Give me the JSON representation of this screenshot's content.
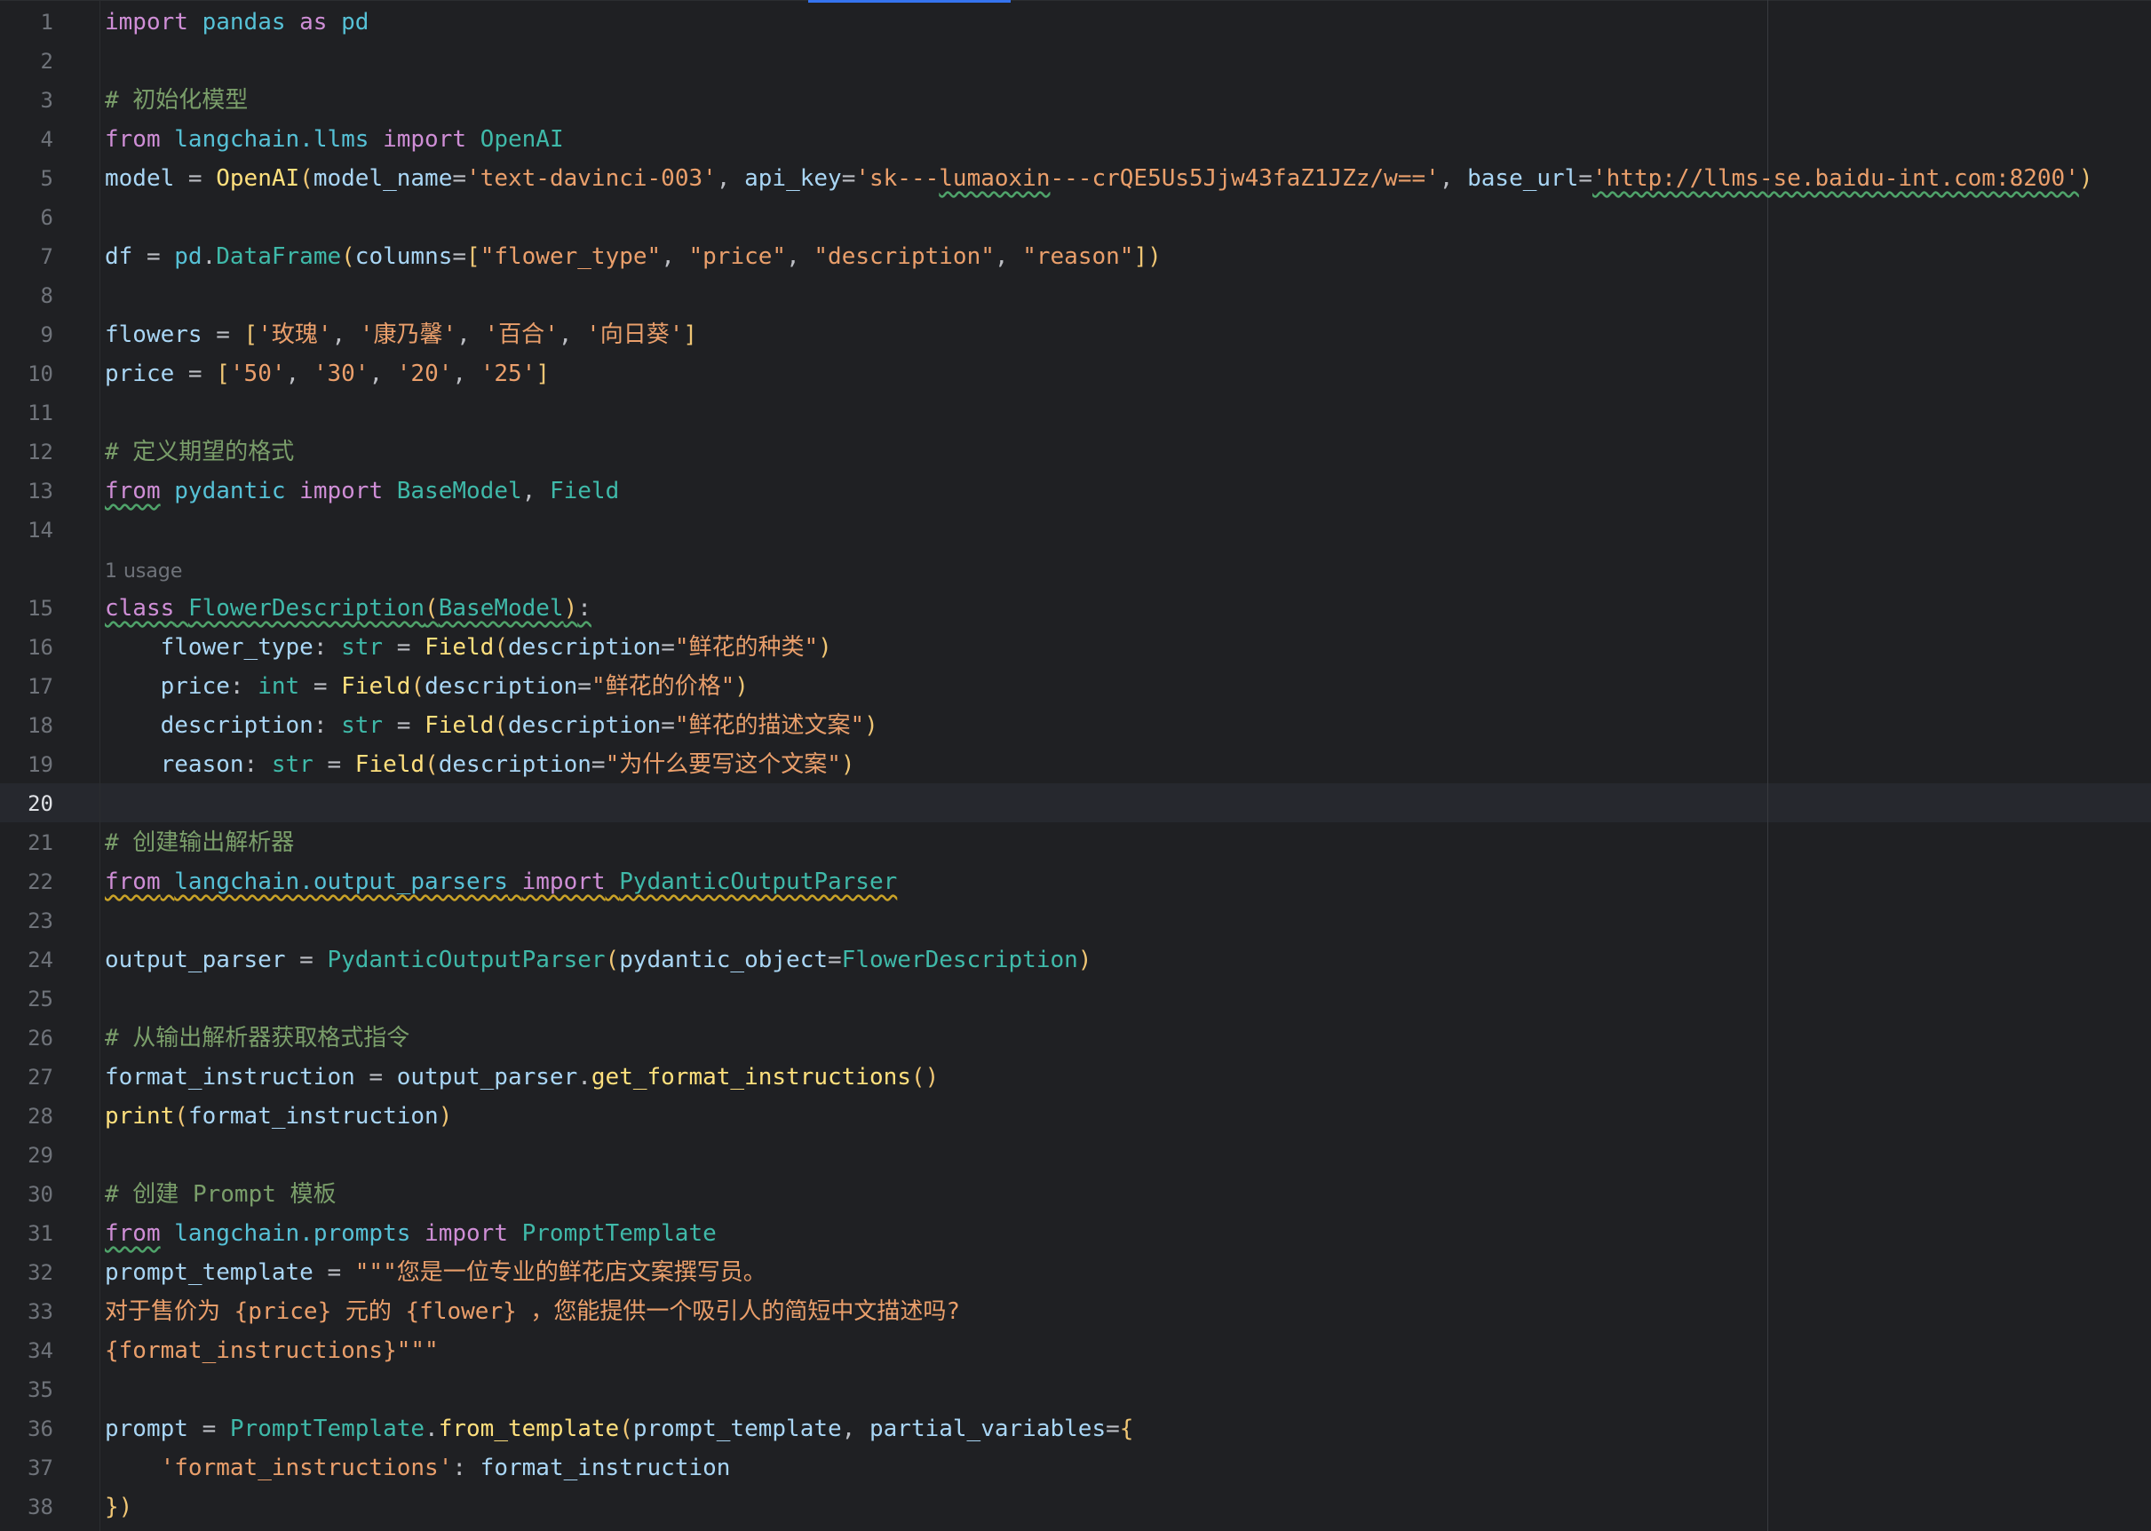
{
  "editor": {
    "lines": [
      {
        "n": "1",
        "t": [
          [
            "kw",
            "import"
          ],
          [
            "op",
            " "
          ],
          [
            "mod",
            "pandas"
          ],
          [
            "op",
            " "
          ],
          [
            "kw",
            "as"
          ],
          [
            "op",
            " "
          ],
          [
            "mod",
            "pd"
          ]
        ]
      },
      {
        "n": "2",
        "t": []
      },
      {
        "n": "3",
        "t": [
          [
            "cm",
            "# 初始化模型"
          ]
        ]
      },
      {
        "n": "4",
        "t": [
          [
            "kw",
            "from"
          ],
          [
            "op",
            " "
          ],
          [
            "mod",
            "langchain.llms"
          ],
          [
            "op",
            " "
          ],
          [
            "kw",
            "import"
          ],
          [
            "op",
            " "
          ],
          [
            "cls",
            "OpenAI"
          ]
        ]
      },
      {
        "n": "5",
        "t": [
          [
            "var",
            "model"
          ],
          [
            "op",
            " = "
          ],
          [
            "fn",
            "OpenAI"
          ],
          [
            "pa",
            "("
          ],
          [
            "var",
            "model_name"
          ],
          [
            "op",
            "="
          ],
          [
            "str",
            "'text-davinci-003'"
          ],
          [
            "op",
            ", "
          ],
          [
            "var",
            "api_key"
          ],
          [
            "op",
            "="
          ],
          [
            "str",
            "'sk---"
          ],
          [
            "str wavy",
            "lumaoxin"
          ],
          [
            "str",
            "---crQE5Us5Jjw43faZ1JZz/w=='"
          ],
          [
            "op",
            ", "
          ],
          [
            "var",
            "base_url"
          ],
          [
            "op",
            "="
          ],
          [
            "str wavy",
            "'http://llms-se.baidu-int.com:8200'"
          ],
          [
            "pa",
            ")"
          ]
        ]
      },
      {
        "n": "6",
        "t": []
      },
      {
        "n": "7",
        "t": [
          [
            "var",
            "df"
          ],
          [
            "op",
            " = "
          ],
          [
            "mod",
            "pd"
          ],
          [
            "op",
            "."
          ],
          [
            "cls",
            "DataFrame"
          ],
          [
            "pa",
            "("
          ],
          [
            "var",
            "columns"
          ],
          [
            "op",
            "="
          ],
          [
            "pa",
            "["
          ],
          [
            "str",
            "\"flower_type\""
          ],
          [
            "op",
            ", "
          ],
          [
            "str",
            "\"price\""
          ],
          [
            "op",
            ", "
          ],
          [
            "str",
            "\"description\""
          ],
          [
            "op",
            ", "
          ],
          [
            "str",
            "\"reason\""
          ],
          [
            "pa",
            "])"
          ]
        ]
      },
      {
        "n": "8",
        "t": []
      },
      {
        "n": "9",
        "t": [
          [
            "var",
            "flowers"
          ],
          [
            "op",
            " = "
          ],
          [
            "pa",
            "["
          ],
          [
            "str",
            "'玫瑰'"
          ],
          [
            "op",
            ", "
          ],
          [
            "str",
            "'康乃馨'"
          ],
          [
            "op",
            ", "
          ],
          [
            "str",
            "'百合'"
          ],
          [
            "op",
            ", "
          ],
          [
            "str",
            "'向日葵'"
          ],
          [
            "pa",
            "]"
          ]
        ]
      },
      {
        "n": "10",
        "t": [
          [
            "var",
            "price"
          ],
          [
            "op",
            " = "
          ],
          [
            "pa",
            "["
          ],
          [
            "str",
            "'50'"
          ],
          [
            "op",
            ", "
          ],
          [
            "str",
            "'30'"
          ],
          [
            "op",
            ", "
          ],
          [
            "str",
            "'20'"
          ],
          [
            "op",
            ", "
          ],
          [
            "str",
            "'25'"
          ],
          [
            "pa",
            "]"
          ]
        ]
      },
      {
        "n": "11",
        "t": []
      },
      {
        "n": "12",
        "t": [
          [
            "cm",
            "# 定义期望的格式"
          ]
        ]
      },
      {
        "n": "13",
        "t": [
          [
            "kw wavy",
            "from"
          ],
          [
            "op",
            " "
          ],
          [
            "mod",
            "pydantic"
          ],
          [
            "op",
            " "
          ],
          [
            "kw",
            "import"
          ],
          [
            "op",
            " "
          ],
          [
            "cls",
            "BaseModel"
          ],
          [
            "op",
            ", "
          ],
          [
            "cls",
            "Field"
          ]
        ]
      },
      {
        "n": "14",
        "t": []
      },
      {
        "hint": "1 usage"
      },
      {
        "n": "15",
        "t": [
          [
            "kw wavy",
            "class"
          ],
          [
            "op wavy",
            " "
          ],
          [
            "cls wavy",
            "FlowerDescription"
          ],
          [
            "pa wavy",
            "("
          ],
          [
            "cls wavy",
            "BaseModel"
          ],
          [
            "pa wavy",
            ")"
          ],
          [
            "op wavy",
            ":"
          ]
        ]
      },
      {
        "n": "16",
        "t": [
          [
            "op",
            "    "
          ],
          [
            "var",
            "flower_type"
          ],
          [
            "op",
            ": "
          ],
          [
            "cls",
            "str"
          ],
          [
            "op",
            " = "
          ],
          [
            "fn",
            "Field"
          ],
          [
            "pa",
            "("
          ],
          [
            "var",
            "description"
          ],
          [
            "op",
            "="
          ],
          [
            "str",
            "\"鲜花的种类\""
          ],
          [
            "pa",
            ")"
          ]
        ]
      },
      {
        "n": "17",
        "t": [
          [
            "op",
            "    "
          ],
          [
            "var",
            "price"
          ],
          [
            "op",
            ": "
          ],
          [
            "cls",
            "int"
          ],
          [
            "op",
            " = "
          ],
          [
            "fn",
            "Field"
          ],
          [
            "pa",
            "("
          ],
          [
            "var",
            "description"
          ],
          [
            "op",
            "="
          ],
          [
            "str",
            "\"鲜花的价格\""
          ],
          [
            "pa",
            ")"
          ]
        ]
      },
      {
        "n": "18",
        "t": [
          [
            "op",
            "    "
          ],
          [
            "var",
            "description"
          ],
          [
            "op",
            ": "
          ],
          [
            "cls",
            "str"
          ],
          [
            "op",
            " = "
          ],
          [
            "fn",
            "Field"
          ],
          [
            "pa",
            "("
          ],
          [
            "var",
            "description"
          ],
          [
            "op",
            "="
          ],
          [
            "str",
            "\"鲜花的描述文案\""
          ],
          [
            "pa",
            ")"
          ]
        ]
      },
      {
        "n": "19",
        "t": [
          [
            "op",
            "    "
          ],
          [
            "var",
            "reason"
          ],
          [
            "op",
            ": "
          ],
          [
            "cls",
            "str"
          ],
          [
            "op",
            " = "
          ],
          [
            "fn",
            "Field"
          ],
          [
            "pa",
            "("
          ],
          [
            "var",
            "description"
          ],
          [
            "op",
            "="
          ],
          [
            "str",
            "\"为什么要写这个文案\""
          ],
          [
            "pa",
            ")"
          ]
        ]
      },
      {
        "n": "20",
        "t": [],
        "current": true
      },
      {
        "n": "21",
        "t": [
          [
            "cm",
            "# 创建输出解析器"
          ]
        ]
      },
      {
        "n": "22",
        "t": [
          [
            "kw wavy-y",
            "from"
          ],
          [
            "op wavy-y",
            " "
          ],
          [
            "mod wavy-y",
            "langchain.output_parsers"
          ],
          [
            "op wavy-y",
            " "
          ],
          [
            "kw wavy-y",
            "import"
          ],
          [
            "op wavy-y",
            " "
          ],
          [
            "cls wavy-y",
            "PydanticOutputParser"
          ]
        ]
      },
      {
        "n": "23",
        "t": []
      },
      {
        "n": "24",
        "t": [
          [
            "var",
            "output_parser"
          ],
          [
            "op",
            " = "
          ],
          [
            "cls",
            "PydanticOutputParser"
          ],
          [
            "pa",
            "("
          ],
          [
            "var",
            "pydantic_object"
          ],
          [
            "op",
            "="
          ],
          [
            "cls",
            "FlowerDescription"
          ],
          [
            "pa",
            ")"
          ]
        ]
      },
      {
        "n": "25",
        "t": []
      },
      {
        "n": "26",
        "t": [
          [
            "cm",
            "# 从输出解析器获取格式指令"
          ]
        ]
      },
      {
        "n": "27",
        "t": [
          [
            "var",
            "format_instruction"
          ],
          [
            "op",
            " = "
          ],
          [
            "var",
            "output_parser"
          ],
          [
            "op",
            "."
          ],
          [
            "fn",
            "get_format_instructions"
          ],
          [
            "pa",
            "()"
          ]
        ]
      },
      {
        "n": "28",
        "t": [
          [
            "fn",
            "print"
          ],
          [
            "pa",
            "("
          ],
          [
            "var",
            "format_instruction"
          ],
          [
            "pa",
            ")"
          ]
        ]
      },
      {
        "n": "29",
        "t": []
      },
      {
        "n": "30",
        "t": [
          [
            "cm",
            "# 创建 Prompt 模板"
          ]
        ]
      },
      {
        "n": "31",
        "t": [
          [
            "kw wavy",
            "from"
          ],
          [
            "op",
            " "
          ],
          [
            "mod",
            "langchain.prompts"
          ],
          [
            "op",
            " "
          ],
          [
            "kw",
            "import"
          ],
          [
            "op",
            " "
          ],
          [
            "cls",
            "PromptTemplate"
          ]
        ]
      },
      {
        "n": "32",
        "t": [
          [
            "var",
            "prompt_template"
          ],
          [
            "op",
            " = "
          ],
          [
            "str",
            "\"\"\"您是一位专业的鲜花店文案撰写员。"
          ]
        ]
      },
      {
        "n": "33",
        "t": [
          [
            "str",
            "对于售价为 {price} 元的 {flower} ，您能提供一个吸引人的简短中文描述吗?"
          ]
        ]
      },
      {
        "n": "34",
        "t": [
          [
            "str",
            "{format_instructions}\"\"\""
          ]
        ]
      },
      {
        "n": "35",
        "t": []
      },
      {
        "n": "36",
        "t": [
          [
            "var",
            "prompt"
          ],
          [
            "op",
            " = "
          ],
          [
            "cls",
            "PromptTemplate"
          ],
          [
            "op",
            "."
          ],
          [
            "fn",
            "from_template"
          ],
          [
            "pa",
            "("
          ],
          [
            "var",
            "prompt_template"
          ],
          [
            "op",
            ", "
          ],
          [
            "var",
            "partial_variables"
          ],
          [
            "op",
            "="
          ],
          [
            "pa",
            "{"
          ]
        ]
      },
      {
        "n": "37",
        "t": [
          [
            "op",
            "    "
          ],
          [
            "str",
            "'format_instructions'"
          ],
          [
            "op",
            ": "
          ],
          [
            "var",
            "format_instruction"
          ]
        ]
      },
      {
        "n": "38",
        "t": [
          [
            "pa",
            "})"
          ]
        ]
      }
    ]
  }
}
